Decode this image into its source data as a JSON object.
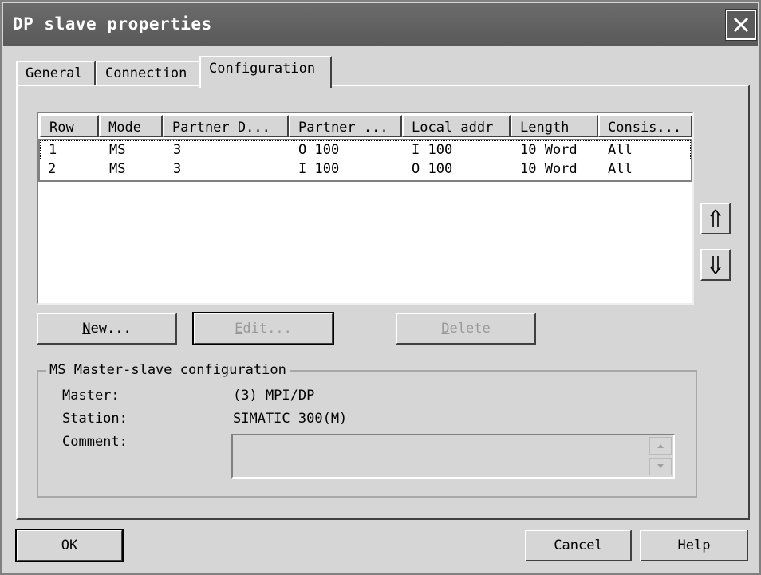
{
  "window": {
    "title": "DP slave properties"
  },
  "tabs": [
    {
      "label": "General"
    },
    {
      "label": "Connection"
    },
    {
      "label": "Configuration"
    }
  ],
  "table": {
    "columns": [
      "Row",
      "Mode",
      "Partner D...",
      "Partner ...",
      "Local addr",
      "Length",
      "Consis..."
    ],
    "rows": [
      [
        "1",
        "MS",
        "3",
        "O 100",
        "I 100",
        "10 Word",
        "All"
      ],
      [
        "2",
        "MS",
        "3",
        "I 100",
        "O 100",
        "10 Word",
        "All"
      ]
    ]
  },
  "actions": {
    "new": "New...",
    "edit": "Edit...",
    "delete": "Delete"
  },
  "group": {
    "title": "MS Master-slave configuration",
    "master_label": "Master:",
    "master_value": "(3) MPI/DP",
    "station_label": "Station:",
    "station_value": "SIMATIC 300(M)",
    "comment_label": "Comment:",
    "comment_value": ""
  },
  "footer": {
    "ok": "OK",
    "cancel": "Cancel",
    "help": "Help"
  },
  "icons": {
    "close": "close-icon",
    "up": "arrow-up-icon",
    "down": "arrow-down-icon"
  }
}
